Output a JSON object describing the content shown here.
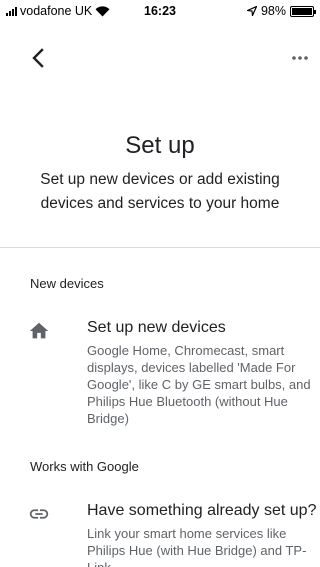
{
  "status": {
    "carrier": "vodafone UK",
    "time": "16:23",
    "battery": "98%",
    "battery_level": 0.98
  },
  "header": {
    "title": "Set up",
    "subtitle": "Set up new devices or add existing devices and services to your home"
  },
  "sections": [
    {
      "heading": "New devices",
      "item": {
        "icon": "home-icon",
        "title": "Set up new devices",
        "description": "Google Home, Chromecast, smart displays, devices labelled 'Made For Google', like C by GE smart bulbs, and Philips Hue Bluetooth (without Hue Bridge)"
      }
    },
    {
      "heading": "Works with Google",
      "item": {
        "icon": "link-icon",
        "title": "Have something already set up?",
        "description": "Link your smart home services like Philips Hue (with Hue Bridge) and TP-Link"
      }
    }
  ],
  "colors": {
    "text_primary": "#202124",
    "text_secondary": "#5f6368",
    "icon": "#5f6368",
    "divider": "#dadce0"
  }
}
